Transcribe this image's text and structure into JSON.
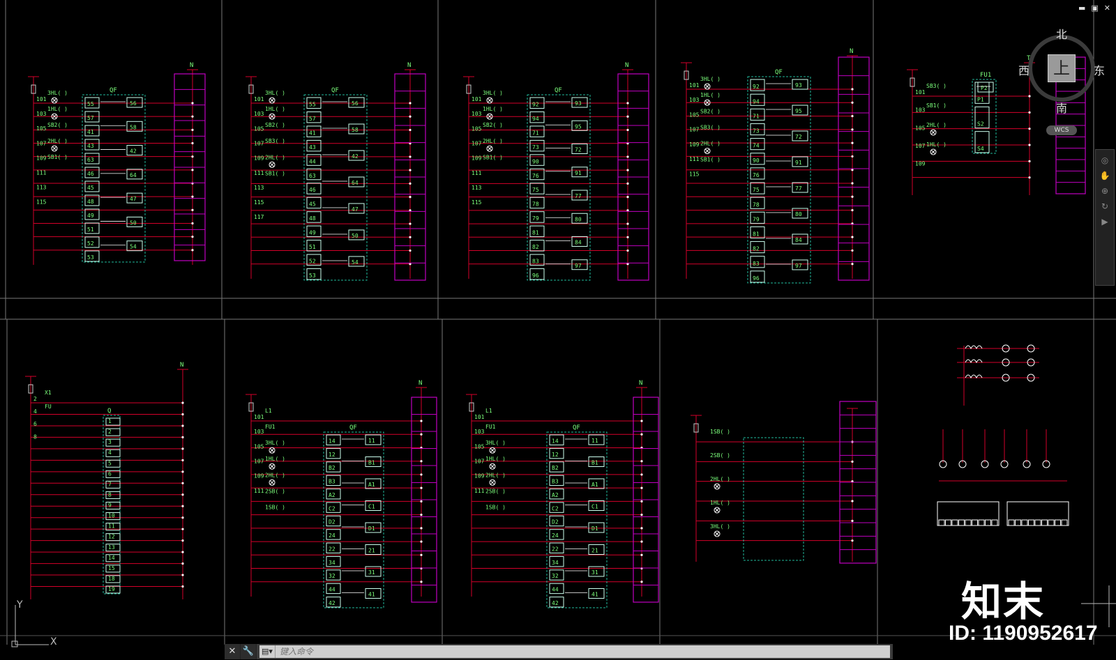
{
  "window": {
    "minimize_label": "▬",
    "restore_label": "▣",
    "close_label": "✕"
  },
  "viewcube": {
    "north": "北",
    "south": "南",
    "west": "西",
    "east": "东",
    "top": "上",
    "wcs": "WCS"
  },
  "command_line": {
    "placeholder": "键入命令",
    "close_icon": "close-icon",
    "customize_icon": "wrench-icon"
  },
  "watermark": {
    "logo_text": "知末",
    "id_text": "ID: 1190952617"
  },
  "colors": {
    "background": "#000000",
    "wire": "#d4002a",
    "terminal": "#c000c0",
    "module": "#1fb89a",
    "text_green": "#7cff7c",
    "text_white": "#ffffff"
  },
  "sheets": [
    {
      "qf_label": "QF",
      "n_label": "N",
      "contacts": [
        "55",
        "57",
        "41",
        "43",
        "63",
        "46",
        "45",
        "48",
        "49",
        "51",
        "52",
        "53"
      ],
      "contacts_right": [
        "56",
        "58",
        "42",
        "64",
        "47",
        "50",
        "54"
      ],
      "wires": [
        "101",
        "103",
        "105",
        "107",
        "109",
        "111",
        "113",
        "115"
      ],
      "lamps": [
        "3HL(  )",
        "1HL(  )",
        "SB2(  )",
        "2HL(  )",
        "SB1(  )"
      ]
    },
    {
      "qf_label": "QF",
      "n_label": "N",
      "contacts": [
        "55",
        "57",
        "41",
        "43",
        "44",
        "63",
        "46",
        "45",
        "48",
        "49",
        "51",
        "52",
        "53"
      ],
      "contacts_right": [
        "56",
        "58",
        "42",
        "64",
        "47",
        "50",
        "54"
      ],
      "wires": [
        "101",
        "103",
        "105",
        "107",
        "109",
        "111",
        "113",
        "115",
        "117"
      ],
      "lamps": [
        "3HL(  )",
        "1HL(  )",
        "SB2(  )",
        "SB3(  )",
        "2HL(  )",
        "SB1(  )"
      ]
    },
    {
      "qf_label": "QF",
      "n_label": "N",
      "contacts": [
        "92",
        "94",
        "71",
        "73",
        "90",
        "76",
        "75",
        "78",
        "79",
        "81",
        "82",
        "83",
        "96"
      ],
      "contacts_right": [
        "93",
        "95",
        "72",
        "91",
        "77",
        "80",
        "84",
        "97"
      ],
      "wires": [
        "101",
        "103",
        "105",
        "107",
        "109",
        "111",
        "113",
        "115"
      ],
      "lamps": [
        "3HL(  )",
        "1HL(  )",
        "SB2(  )",
        "2HL(  )",
        "SB1(  )"
      ]
    },
    {
      "qf_label": "QF",
      "n_label": "N",
      "contacts": [
        "92",
        "94",
        "71",
        "73",
        "74",
        "90",
        "76",
        "75",
        "78",
        "79",
        "81",
        "82",
        "83",
        "96"
      ],
      "contacts_right": [
        "93",
        "95",
        "72",
        "91",
        "77",
        "80",
        "84",
        "97"
      ],
      "wires": [
        "101",
        "103",
        "105",
        "107",
        "109",
        "111",
        "115"
      ],
      "lamps": [
        "3HL(  )",
        "1HL(  )",
        "SB2(  )",
        "SB3(  )",
        "2HL(  )",
        "SB1(  )"
      ]
    },
    {
      "qf_label": "FU1",
      "n_label": "T",
      "contacts": [
        "P1",
        "S2",
        "S4"
      ],
      "contacts_right": [
        "P2"
      ],
      "wires": [
        "101",
        "103",
        "105",
        "107",
        "109"
      ],
      "lamps": [
        "SB3(  )",
        "SB1(  )",
        "2HL(  )",
        "1HL(  )"
      ]
    },
    {
      "qf_label": "Q",
      "n_label": "N",
      "contacts": [
        "1",
        "2",
        "3",
        "4",
        "5",
        "6",
        "7",
        "8",
        "9",
        "10",
        "11",
        "12",
        "13",
        "14",
        "15",
        "18",
        "19"
      ],
      "contacts_right": [],
      "wires": [
        "2",
        "4",
        "6",
        "8"
      ],
      "lamps": [
        "X1",
        "FU"
      ]
    },
    {
      "qf_label": "QF",
      "n_label": "N",
      "contacts": [
        "14",
        "12",
        "B2",
        "B3",
        "A2",
        "C2",
        "D2",
        "24",
        "22",
        "34",
        "32",
        "44",
        "42"
      ],
      "contacts_right": [
        "11",
        "B1",
        "A1",
        "C1",
        "D1",
        "21",
        "31",
        "41"
      ],
      "wires": [
        "101",
        "103",
        "105",
        "107",
        "109",
        "111"
      ],
      "lamps": [
        "L1",
        "FU1",
        "3HL(  )",
        "1HL(  )",
        "2HL(  )",
        "2SB(  )",
        "1SB(  )"
      ]
    },
    {
      "qf_label": "QF",
      "n_label": "N",
      "contacts": [
        "14",
        "12",
        "B2",
        "B3",
        "A2",
        "C2",
        "D2",
        "24",
        "22",
        "34",
        "32",
        "44",
        "42"
      ],
      "contacts_right": [
        "11",
        "B1",
        "A1",
        "C1",
        "D1",
        "21",
        "31",
        "41"
      ],
      "wires": [
        "101",
        "103",
        "105",
        "107",
        "109",
        "111"
      ],
      "lamps": [
        "L1",
        "FU1",
        "3HL(  )",
        "1HL(  )",
        "2HL(  )",
        "2SB(  )",
        "1SB(  )"
      ]
    },
    {
      "qf_label": "",
      "n_label": "",
      "contacts": [],
      "contacts_right": [],
      "wires": [],
      "lamps": [
        "1SB(  )",
        "2SB(  )",
        "2HL(  )",
        "1HL(  )",
        "3HL(  )"
      ]
    }
  ],
  "axes": {
    "y_label": "Y",
    "x_label": "X"
  }
}
